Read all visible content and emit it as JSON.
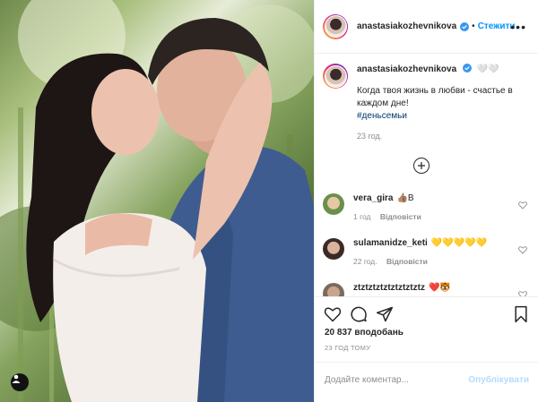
{
  "post": {
    "username": "anastasiakozhevnikova",
    "follow_label": "Стежити",
    "more_icon": "more-horizontal-icon",
    "verified_icon": "verified-badge-icon",
    "user_tag_icon": "user-tag-icon",
    "accent_color": "#0095f6",
    "caption": {
      "username": "anastasiakozhevnikova",
      "emoji": "🤍🤍",
      "text": "Когда твоя жизнь в любви - счастье в каждом дне!",
      "hashtag": "#деньсемьи",
      "time": "23 год."
    },
    "load_more_icon": "plus-circle-icon",
    "comments": [
      {
        "username": "vera_gira",
        "text": "👍🏽B",
        "time": "1 год",
        "reply_label": "Відповісти"
      },
      {
        "username": "sulamanidze_keti",
        "text": "💛💛💛💛💛",
        "time": "22 год.",
        "reply_label": "Відповісти"
      },
      {
        "username": "ztztztztztztztztztz",
        "text": "❤️🐯",
        "time": "",
        "reply_label": ""
      }
    ],
    "actions": {
      "like_icon": "heart-icon",
      "comment_icon": "comment-icon",
      "share_icon": "share-icon",
      "save_icon": "bookmark-icon"
    },
    "likes": "20 837 вподобань",
    "date": "23 ГОД ТОМУ",
    "add_comment_placeholder": "Додайте коментар...",
    "publish_label": "Опублікувати"
  }
}
